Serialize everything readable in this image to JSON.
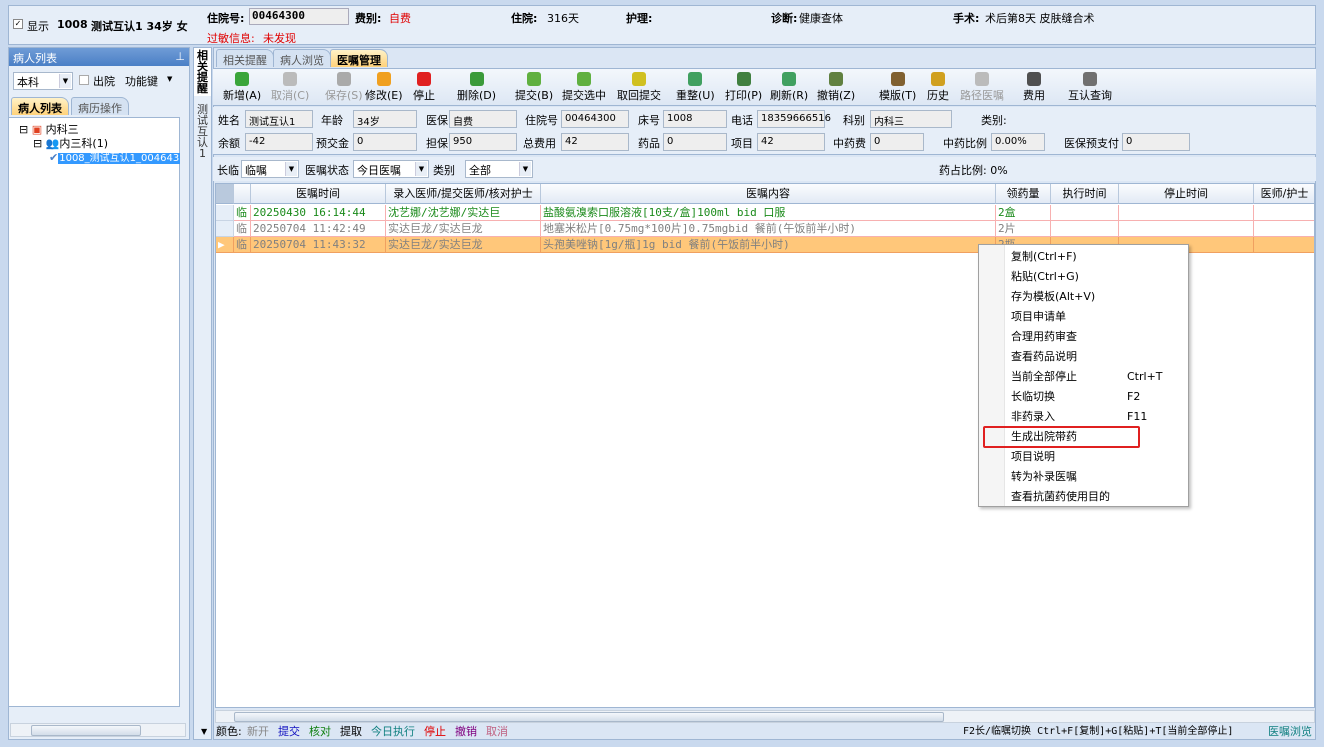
{
  "header": {
    "show_label": "显示",
    "bed": "1008",
    "patient": "测试互认1 34岁 女",
    "admission_no_label": "住院号:",
    "admission_no": "00464300",
    "fee_type_label": "费别:",
    "fee_type": "自费",
    "stay_label": "住院:",
    "stay": "316天",
    "nursing_label": "护理:",
    "diagnosis_label": "诊断:",
    "diagnosis": "健康查体",
    "surgery_label": "手术:",
    "surgery": "术后第8天 皮肤缝合术",
    "allergy_label": "过敏信息:",
    "allergy": "未发现"
  },
  "left": {
    "title": "病人列表",
    "dept": "本科",
    "discharged_label": "出院",
    "func_label": "功能键",
    "tabs": [
      "病人列表",
      "病历操作"
    ],
    "tree": {
      "root": "内科三",
      "child": "内三科(1)",
      "patient": "1008_测试互认1_004643"
    }
  },
  "vtabs": {
    "reminder": "相关提醒",
    "patient": "测试互认1"
  },
  "tabs": [
    "相关提醒",
    "病人浏览",
    "医嘱管理"
  ],
  "toolbar": [
    {
      "label": "新增(A)",
      "color": "#3aa53a"
    },
    {
      "label": "取消(C)",
      "color": "#bbbbbb",
      "disabled": true
    },
    {
      "label": "保存(S)",
      "color": "#aaaaaa",
      "disabled": true
    },
    {
      "label": "修改(E)",
      "color": "#f0a020"
    },
    {
      "label": "停止",
      "color": "#e02020"
    },
    {
      "label": "删除(D)",
      "color": "#3a9a3a"
    },
    {
      "label": "提交(B)",
      "color": "#60b040"
    },
    {
      "label": "提交选中",
      "color": "#60b040"
    },
    {
      "label": "取回提交",
      "color": "#d0c020"
    },
    {
      "label": "重整(U)",
      "color": "#40a060"
    },
    {
      "label": "打印(P)",
      "color": "#408040"
    },
    {
      "label": "刷新(R)",
      "color": "#40a060"
    },
    {
      "label": "撤销(Z)",
      "color": "#608040"
    },
    {
      "label": "模版(T)",
      "color": "#806030"
    },
    {
      "label": "历史",
      "color": "#d0a020"
    },
    {
      "label": "路径医嘱",
      "color": "#bbbbbb",
      "disabled": true
    },
    {
      "label": "费用",
      "color": "#505050"
    },
    {
      "label": "互认查询",
      "color": "#707070"
    }
  ],
  "patient_info": {
    "name_label": "姓名",
    "name": "测试互认1",
    "age_label": "年龄",
    "age": "34岁",
    "insurance_label": "医保",
    "insurance": "自费",
    "admission_label": "住院号",
    "admission": "00464300",
    "bed_label": "床号",
    "bed": "1008",
    "phone_label": "电话",
    "phone": "18359666516",
    "dept_label": "科别",
    "dept": "内科三",
    "category_label": "类别:",
    "balance_label": "余额",
    "balance": "-42",
    "prepay_label": "预交金",
    "prepay": "0",
    "guarantee_label": "担保",
    "guarantee": "950",
    "total_label": "总费用",
    "total": "42",
    "drug_label": "药品",
    "drug": "0",
    "item_label": "项目",
    "item": "42",
    "tcm_label": "中药费",
    "tcm": "0",
    "tcm_ratio_label": "中药比例",
    "tcm_ratio": "0.00%",
    "ins_prepay_label": "医保预支付",
    "ins_prepay": "0"
  },
  "filter": {
    "type_label": "长临",
    "type": "临嘱",
    "status_label": "医嘱状态",
    "status": "今日医嘱",
    "category_label": "类别",
    "category": "全部",
    "drug_ratio": "药占比例: 0%"
  },
  "grid": {
    "columns": [
      "医嘱时间",
      "录入医师/提交医师/核对护士",
      "医嘱内容",
      "领药量",
      "执行时间",
      "停止时间",
      "医师/护士"
    ],
    "rows": [
      {
        "flag": "临",
        "time": "20250430 16:14:44",
        "doctor": "沈艺娜/沈艺娜/实达巨",
        "content": "盐酸氨溴索口服溶液[10支/盒]100ml bid 口服",
        "qty": "2盒",
        "color": "#1a8a1a"
      },
      {
        "flag": "临",
        "time": "20250704 11:42:49",
        "doctor": "实达巨龙/实达巨龙",
        "content": "地塞米松片[0.75mg*100片]0.75mgbid 餐前(午饭前半小时)",
        "qty": "2片",
        "color": "#808080"
      },
      {
        "flag": "临",
        "time": "20250704 11:43:32",
        "doctor": "实达巨龙/实达巨龙",
        "content": "头孢美唑钠[1g/瓶]1g bid 餐前(午饭前半小时)",
        "qty": "2瓶",
        "color": "#808080",
        "selected": true
      }
    ]
  },
  "context_menu": [
    {
      "label": "复制(Ctrl+F)"
    },
    {
      "label": "粘贴(Ctrl+G)"
    },
    {
      "label": "存为模板(Alt+V)"
    },
    {
      "label": "项目申请单"
    },
    {
      "label": "合理用药审查"
    },
    {
      "label": "查看药品说明"
    },
    {
      "label": "当前全部停止",
      "shortcut": "Ctrl+T"
    },
    {
      "label": "长临切换",
      "shortcut": "F2"
    },
    {
      "label": "非药录入",
      "shortcut": "F11"
    },
    {
      "label": "生成出院带药",
      "highlighted": true
    },
    {
      "label": "项目说明"
    },
    {
      "label": "转为补录医嘱"
    },
    {
      "label": "查看抗菌药使用目的"
    }
  ],
  "status": {
    "color_label": "颜色:",
    "legend": [
      {
        "label": "新开",
        "color": "#888888"
      },
      {
        "label": "提交",
        "color": "#1010c0"
      },
      {
        "label": "核对",
        "color": "#108010"
      },
      {
        "label": "提取",
        "color": "#000000"
      },
      {
        "label": "今日执行",
        "color": "#108080"
      },
      {
        "label": "停止",
        "color": "#e00000"
      },
      {
        "label": "撤销",
        "color": "#800080"
      },
      {
        "label": "取消",
        "color": "#c06080"
      }
    ],
    "hint": "F2长/临嘱切换 Ctrl+F[复制]+G[粘贴]+T[当前全部停止]",
    "browse": "医嘱浏览"
  }
}
